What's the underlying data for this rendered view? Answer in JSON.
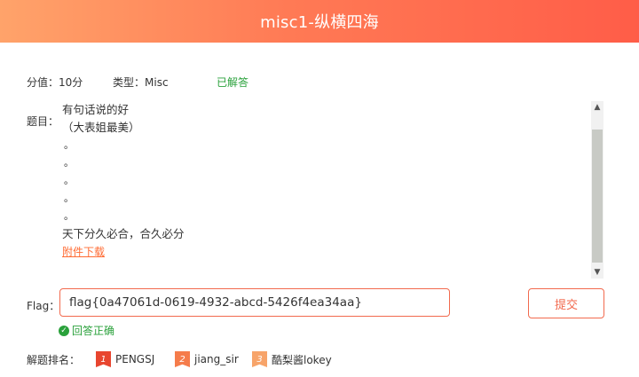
{
  "header": {
    "title": "misc1-纵横四海"
  },
  "meta": {
    "score": "分值：10分",
    "type": "类型：Misc",
    "status": "已解答"
  },
  "question": {
    "label": "题目：",
    "lines": [
      "有句话说的好",
      "（大表姐最美）",
      "。",
      "。",
      "。",
      "。",
      "。",
      "天下分久必合，合久必分"
    ],
    "attachment": "附件下载"
  },
  "flag": {
    "label": "Flag：",
    "value": "flag{0a47061d-0619-4932-abcd-5426f4ea34aa}",
    "submit_label": "提交",
    "result": "回答正确"
  },
  "ranking": {
    "label": "解题排名：",
    "entries": [
      {
        "rank": "1",
        "name": "PENGSJ",
        "color": "#e8452f"
      },
      {
        "rank": "2",
        "name": "jiang_sir",
        "color": "#f57c4b"
      },
      {
        "rank": "3",
        "name": "酷梨酱lokey",
        "color": "#f7a46a"
      }
    ]
  },
  "colors": {
    "accent": "#f26a4e",
    "success": "#2aa13b",
    "header_start": "#ffa36a",
    "header_end": "#ff5d48"
  }
}
